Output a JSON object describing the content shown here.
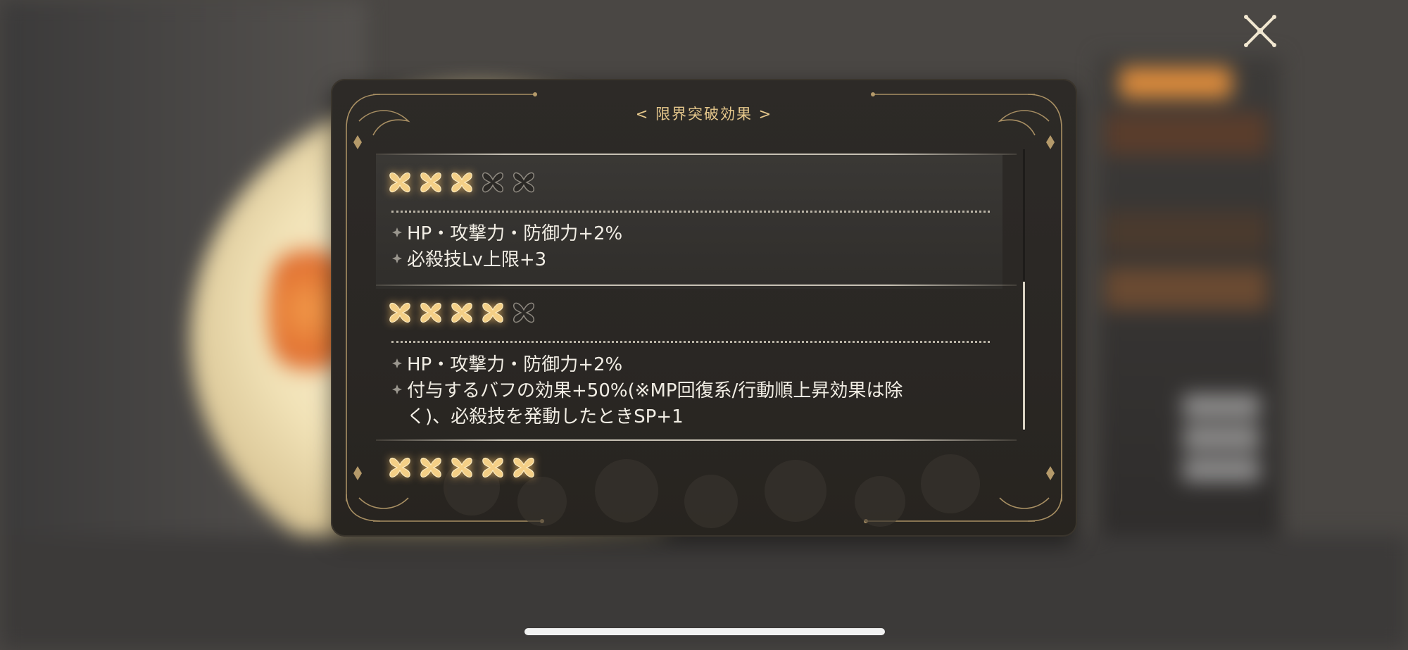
{
  "modal": {
    "title": "< 限界突破効果 >"
  },
  "tiers": [
    {
      "stars_filled": 3,
      "stars_total": 5,
      "effects": [
        "HP・攻撃力・防御力+2%",
        "必殺技Lv上限+3"
      ]
    },
    {
      "stars_filled": 4,
      "stars_total": 5,
      "effects": [
        "HP・攻撃力・防御力+2%",
        "付与するバフの効果+50%(※MP回復系/行動順上昇効果は除",
        "く)、必殺技を発動したときSP+1"
      ]
    },
    {
      "stars_filled": 5,
      "stars_total": 5,
      "effects": []
    }
  ],
  "icons": {
    "close": "close-icon",
    "star_filled": "star-filled-icon",
    "star_empty": "star-empty-icon",
    "bullet": "diamond-bullet-icon"
  },
  "colors": {
    "title_gold": "#e6c88c",
    "star_gold": "#f4cf86",
    "text": "#f1ede4",
    "panel": "#2d2a27"
  }
}
